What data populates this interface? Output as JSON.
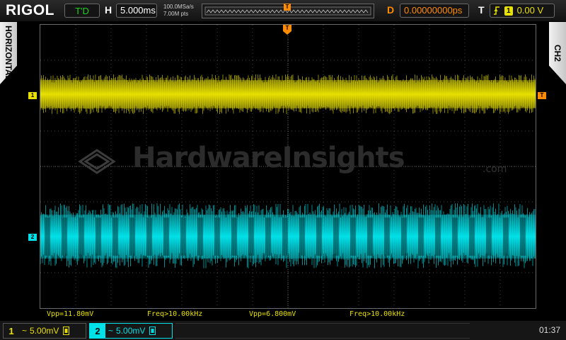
{
  "brand": "RIGOL",
  "run_status": "T'D",
  "timebase": {
    "label": "H",
    "value": "5.000ms",
    "sample_rate": "100.0MSa/s",
    "memory_depth": "7.00M pts"
  },
  "memory_bar": {
    "trigger_marker": "T"
  },
  "delay": {
    "label": "D",
    "value": "0.00000000ps"
  },
  "trigger": {
    "label": "T",
    "source_badge": "1",
    "level": "0.00 V"
  },
  "side_tabs": {
    "left": "HORIZONTAL",
    "right": "CH2"
  },
  "waveform_markers": {
    "ch1": "1",
    "ch2": "2",
    "trigger_top": "T",
    "trigger_level": "T"
  },
  "watermark": {
    "text": "HardwareInsights",
    "suffix": ".com"
  },
  "measurements": {
    "ch1_vpp": "Vpp=11.80mV",
    "ch1_freq": "Freq>10.00kHz",
    "ch2_vpp": "Vpp=6.800mV",
    "ch2_freq": "Freq>10.00kHz"
  },
  "channels": [
    {
      "num": "1",
      "coupling": "~",
      "scale": "5.00mV",
      "color": "#e8e000"
    },
    {
      "num": "2",
      "coupling": "~",
      "scale": "5.00mV",
      "color": "#00e0e8"
    }
  ],
  "clock": "01:37",
  "colors": {
    "ch1": "#e8e000",
    "ch2": "#00e0e8",
    "trigger": "#ff8c00",
    "run": "#20d020",
    "grid": "#6b6b6b"
  }
}
